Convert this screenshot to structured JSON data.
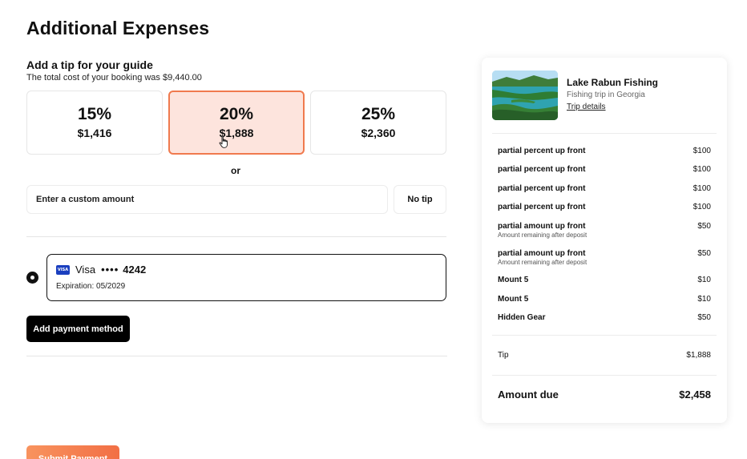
{
  "page": {
    "title": "Additional Expenses"
  },
  "tip": {
    "heading": "Add a tip for your guide",
    "subtext": "The total cost of your booking was $9,440.00",
    "options": [
      {
        "percent": "15%",
        "amount": "$1,416",
        "selected": false
      },
      {
        "percent": "20%",
        "amount": "$1,888",
        "selected": true
      },
      {
        "percent": "25%",
        "amount": "$2,360",
        "selected": false
      }
    ],
    "or_label": "or",
    "custom_placeholder": "Enter a custom amount",
    "no_tip_label": "No tip"
  },
  "payment": {
    "card_brand": "Visa",
    "card_dots": "••••",
    "card_last4": "4242",
    "card_expiration": "Expiration: 05/2029",
    "visa_badge": "VISA",
    "add_method_label": "Add payment method",
    "submit_label": "Submit Payment"
  },
  "summary": {
    "trip_title": "Lake Rabun Fishing",
    "trip_subtitle": "Fishing trip in Georgia",
    "trip_link": "Trip details",
    "line_items": [
      {
        "label": "partial percent up front",
        "sub": "",
        "amount": "$100"
      },
      {
        "label": "partial percent up front",
        "sub": "",
        "amount": "$100"
      },
      {
        "label": "partial percent up front",
        "sub": "",
        "amount": "$100"
      },
      {
        "label": "partial percent up front",
        "sub": "",
        "amount": "$100"
      },
      {
        "label": "partial amount up front",
        "sub": "Amount remaining after deposit",
        "amount": "$50"
      },
      {
        "label": "partial amount up front",
        "sub": "Amount remaining after deposit",
        "amount": "$50"
      },
      {
        "label": "Mount 5",
        "sub": "",
        "amount": "$10"
      },
      {
        "label": "Mount 5",
        "sub": "",
        "amount": "$10"
      },
      {
        "label": "Hidden Gear",
        "sub": "",
        "amount": "$50"
      }
    ],
    "tip_label": "Tip",
    "tip_amount": "$1,888",
    "due_label": "Amount due",
    "due_amount": "$2,458"
  },
  "colors": {
    "accent": "#f07a4e",
    "selected_bg": "#fde4dd",
    "visa_blue": "#1a3fbf"
  },
  "icons": {
    "cursor": "hand-pointer-icon",
    "radio": "radio-selected-icon",
    "card": "visa-card-icon"
  }
}
